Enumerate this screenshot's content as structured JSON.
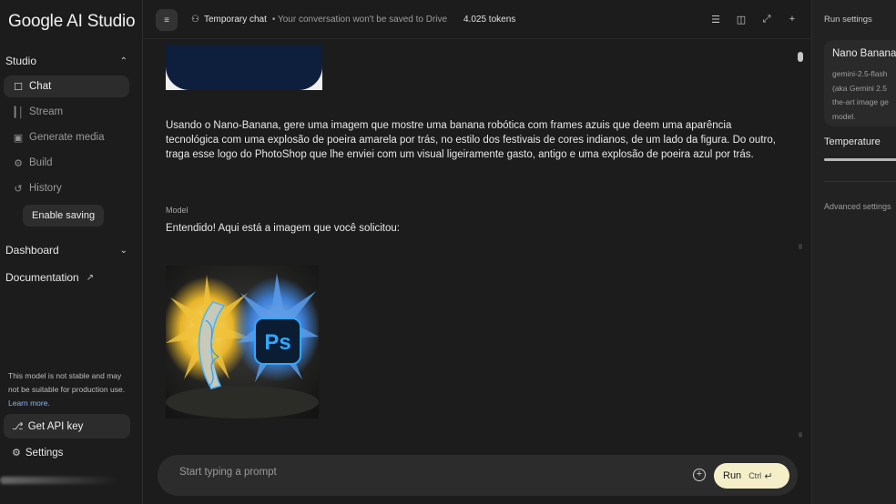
{
  "app": {
    "title": "Google AI Studio"
  },
  "sidebar": {
    "studio_label": "Studio",
    "items": [
      {
        "label": "Chat",
        "icon": "chat-icon",
        "active": true
      },
      {
        "label": "Stream",
        "icon": "stream-icon",
        "active": false
      },
      {
        "label": "Generate media",
        "icon": "media-icon",
        "active": false
      },
      {
        "label": "Build",
        "icon": "build-icon",
        "active": false
      },
      {
        "label": "History",
        "icon": "history-icon",
        "active": false
      }
    ],
    "enable_saving": "Enable saving",
    "dashboard_label": "Dashboard",
    "documentation_label": "Documentation",
    "notice": "This model is not stable and may not be suitable for production use.",
    "notice_link": "Learn more.",
    "get_api_key": "Get API key",
    "settings": "Settings"
  },
  "topbar": {
    "chat_title": "Temporary chat",
    "chat_subtitle": "• Your conversation won't be saved to Drive",
    "tokens": "4.025 tokens",
    "icons": [
      "document-icon",
      "compare-icon",
      "collapse-icon",
      "new-chat-icon"
    ]
  },
  "conversation": {
    "user_message": "Usando o Nano-Banana, gere uma imagem que mostre uma banana robótica com frames azuis que deem uma aparência tecnológica com uma explosão de poeira amarela por trás, no estilo dos festivais de cores indianos, de um lado da figura. Do outro, traga esse logo do PhotoShop que lhe enviei com um visual ligeiramente gasto, antigo e uma explosão de poeira azul por trás.",
    "model_label": "Model",
    "model_message": "Entendido! Aqui está a imagem que você solicitou:",
    "image_logo_text": "Ps"
  },
  "prompt": {
    "placeholder": "Start typing a prompt",
    "run_label": "Run",
    "shortcut": "Ctrl"
  },
  "run_settings": {
    "title": "Run settings",
    "model_name": "Nano Banana",
    "model_desc_lines": [
      "gemini-2.5-flash",
      "(aka Gemini 2.5",
      "the-art image ge",
      "model."
    ],
    "temperature_label": "Temperature",
    "advanced_label": "Advanced settings"
  },
  "colors": {
    "background": "#1c1c1c",
    "run_button": "#f4efc8",
    "link": "#8ab4f8",
    "dust_yellow": "#e8b52a",
    "dust_blue": "#3d7fd6"
  }
}
